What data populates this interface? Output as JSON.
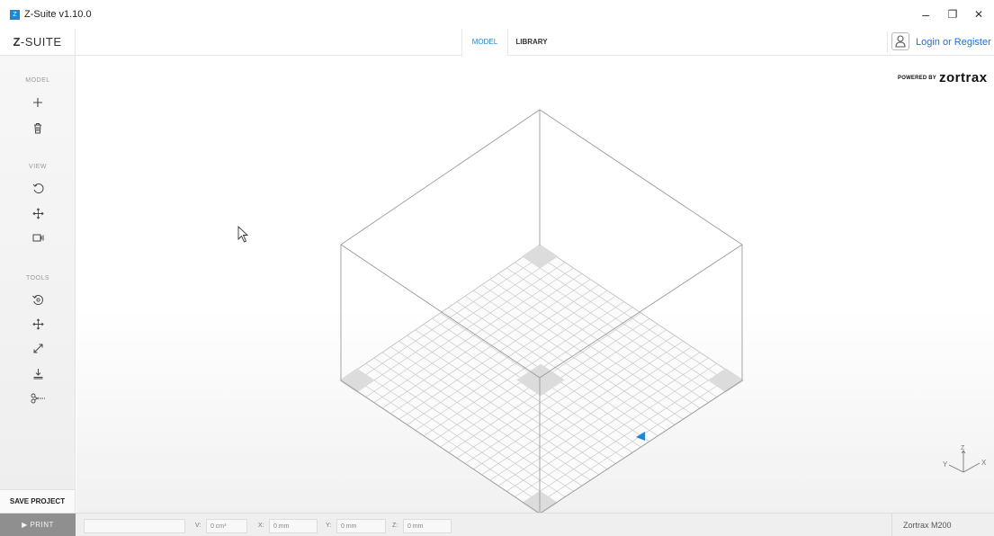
{
  "window": {
    "title": "Z-Suite v1.10.0",
    "minimize": "–",
    "restore": "❐",
    "close": "✕"
  },
  "header": {
    "logo_prefix": "Z",
    "logo_suffix": "-SUITE",
    "tabs": [
      {
        "label": "MODEL",
        "active": true
      },
      {
        "label": "LIBRARY",
        "active": false
      }
    ],
    "login_label": "Login or Register"
  },
  "sidebar": {
    "sections": [
      {
        "label": "MODEL",
        "tools": [
          "add-icon",
          "trash-icon"
        ]
      },
      {
        "label": "VIEW",
        "tools": [
          "rotate-view-icon",
          "pan-view-icon",
          "camera-icon"
        ]
      },
      {
        "label": "TOOLS",
        "tools": [
          "rotate-tool-icon",
          "move-tool-icon",
          "scale-tool-icon",
          "place-on-bed-icon",
          "cut-icon"
        ]
      }
    ],
    "save_label": "SAVE PROJECT"
  },
  "viewport": {
    "powered_by": "POWERED BY",
    "brand": "zortrax",
    "axes": {
      "x": "X",
      "y": "Y",
      "z": "Z"
    }
  },
  "bottom": {
    "print_label": "▶  PRINT",
    "stats": [
      {
        "label": "V:",
        "value": "0 cm³"
      },
      {
        "label": "X:",
        "value": "0 mm"
      },
      {
        "label": "Y:",
        "value": "0 mm"
      },
      {
        "label": "Z:",
        "value": "0 mm"
      }
    ],
    "printer": "Zortrax M200"
  },
  "colors": {
    "accent": "#1e88d6",
    "link": "#1e6fd6",
    "print_button": "#8f8f8f"
  }
}
